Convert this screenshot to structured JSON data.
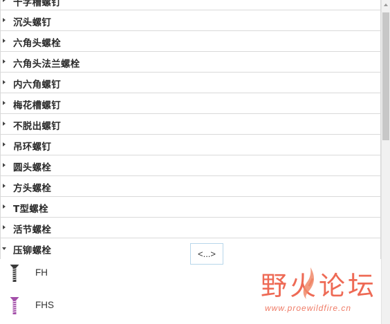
{
  "tree": {
    "categories": [
      {
        "label": "十字槽螺钉"
      },
      {
        "label": "沉头螺钉"
      },
      {
        "label": "六角头螺栓"
      },
      {
        "label": "六角头法兰螺栓"
      },
      {
        "label": "内六角螺钉"
      },
      {
        "label": "梅花槽螺钉"
      },
      {
        "label": "不脱出螺钉"
      },
      {
        "label": "吊环螺钉"
      },
      {
        "label": "圆头螺栓"
      },
      {
        "label": "方头螺栓"
      },
      {
        "label": "T型螺栓"
      },
      {
        "label": "活节螺栓"
      }
    ],
    "expanded": {
      "label": "压铆螺栓",
      "children": [
        {
          "label": "FH",
          "icon": "screw-dark-icon",
          "color": "#3a3a3a"
        },
        {
          "label": "FHS",
          "icon": "screw-purple-icon",
          "color": "#a34fa9"
        }
      ]
    }
  },
  "more_button": {
    "label": "<...>"
  },
  "watermark": {
    "title_part1": "野火",
    "title_part2": "论坛",
    "url": "www.proewildfire.cn"
  }
}
